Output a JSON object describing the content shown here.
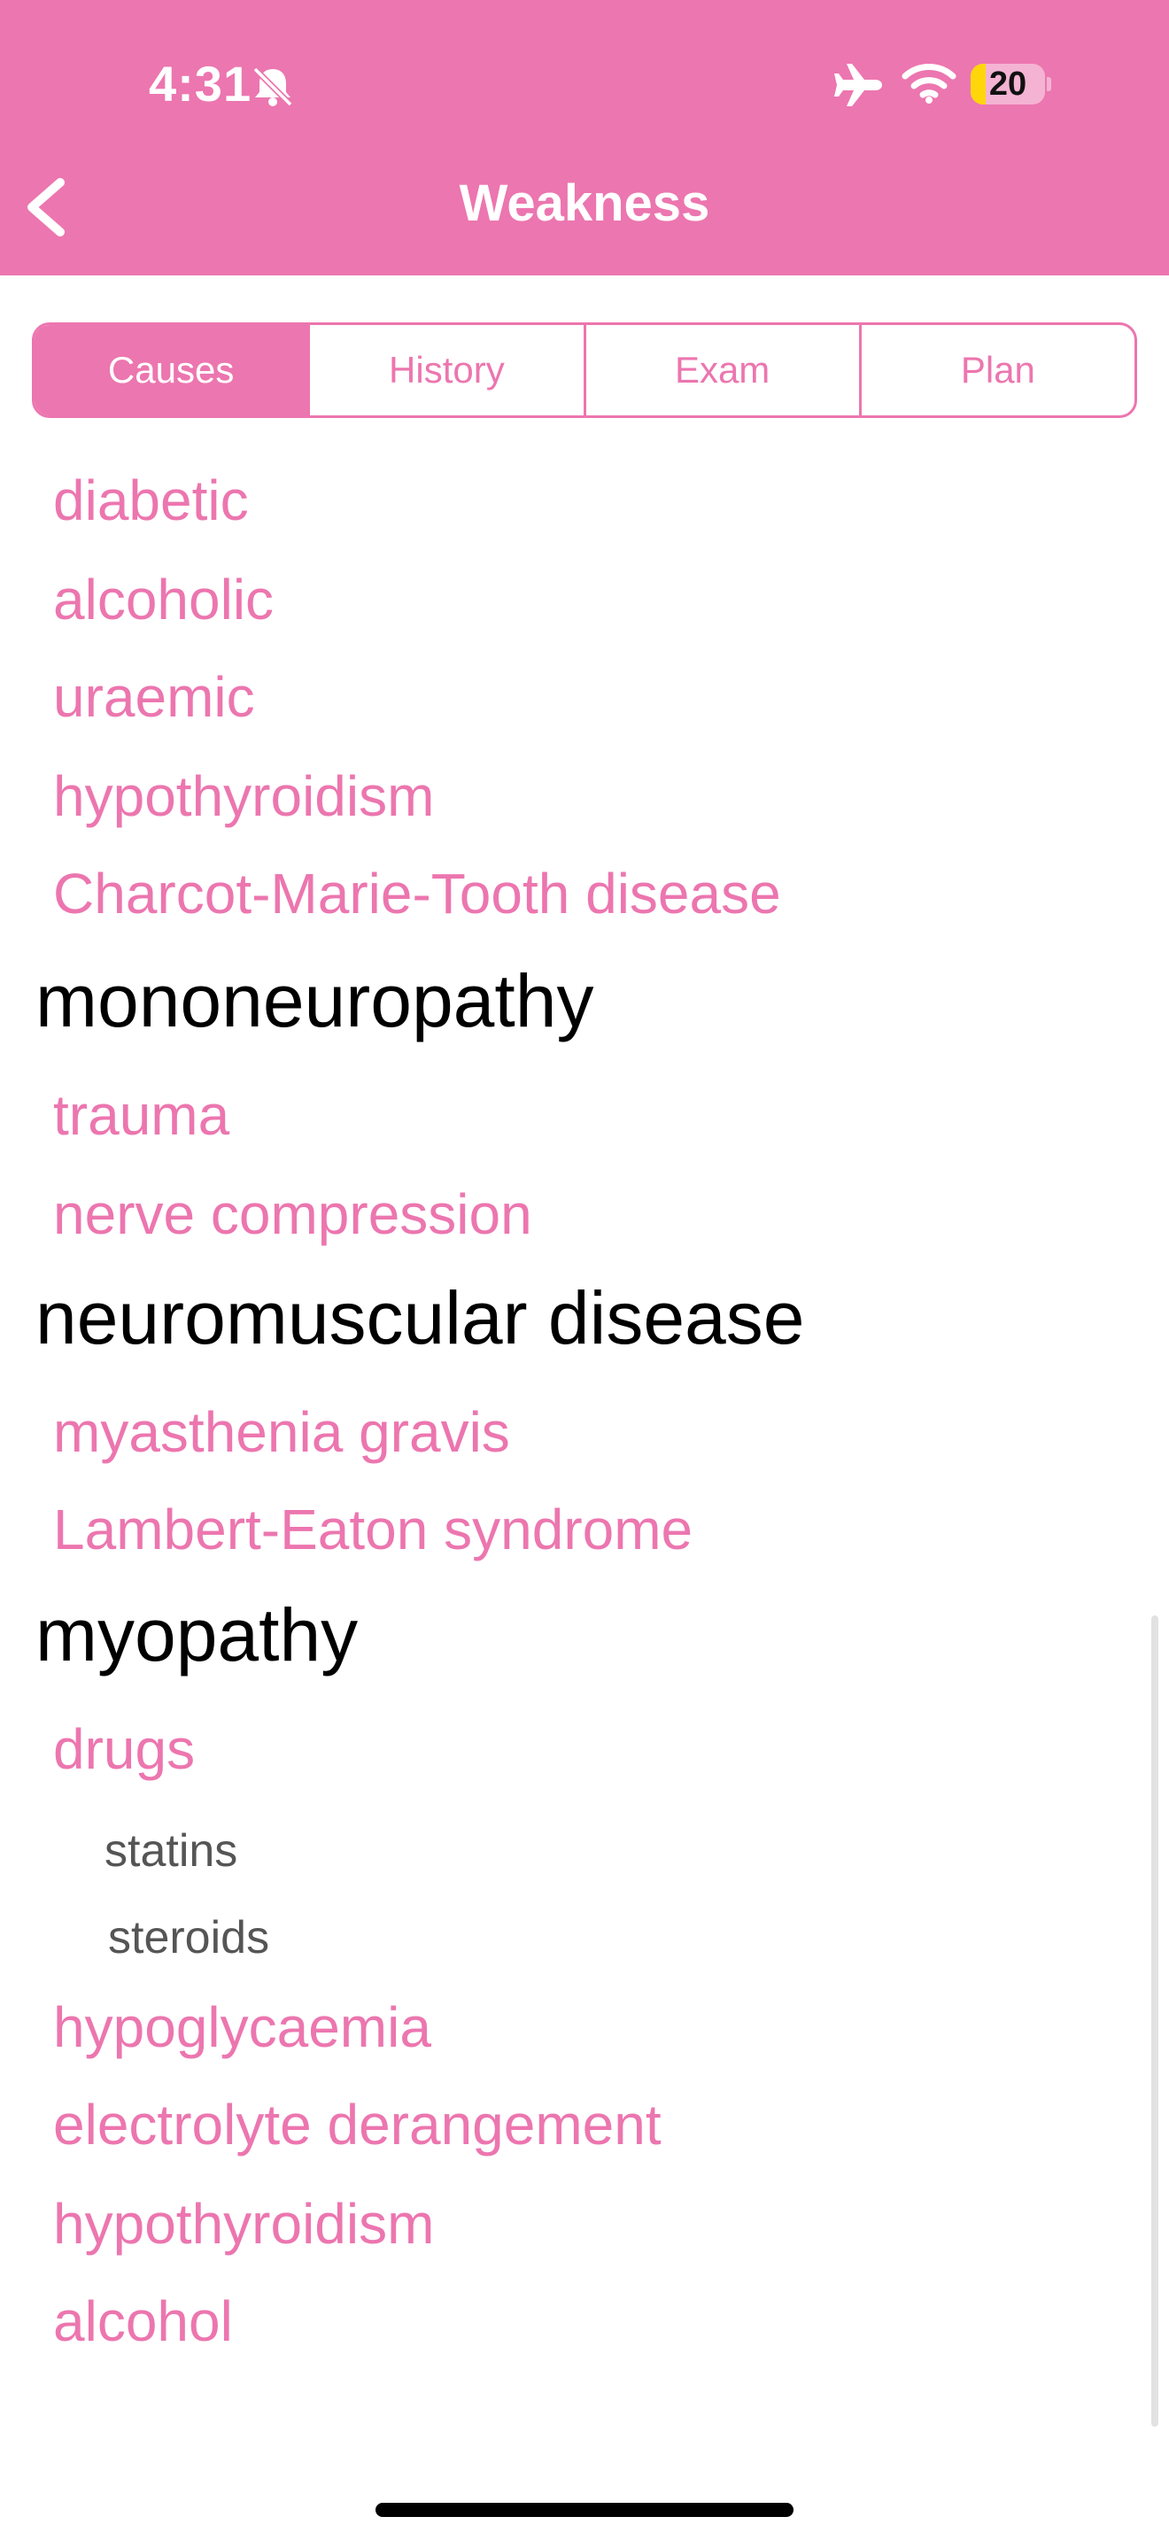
{
  "status_bar": {
    "time": "4:31",
    "battery": "20",
    "battery_level": 0.2
  },
  "nav": {
    "title": "Weakness"
  },
  "tabs": [
    {
      "label": "Causes",
      "active": true
    },
    {
      "label": "History",
      "active": false
    },
    {
      "label": "Exam",
      "active": false
    },
    {
      "label": "Plan",
      "active": false
    }
  ],
  "list": [
    {
      "type": "item",
      "text": "diabetic"
    },
    {
      "type": "item",
      "text": "alcoholic"
    },
    {
      "type": "item",
      "text": "uraemic"
    },
    {
      "type": "item",
      "text": "hypothyroidism"
    },
    {
      "type": "item",
      "text": "Charcot-Marie-Tooth disease"
    },
    {
      "type": "heading",
      "text": "mononeuropathy"
    },
    {
      "type": "item",
      "text": "trauma"
    },
    {
      "type": "item",
      "text": "nerve compression"
    },
    {
      "type": "heading",
      "text": "neuromuscular disease"
    },
    {
      "type": "item",
      "text": "myasthenia gravis"
    },
    {
      "type": "item",
      "text": "Lambert-Eaton syndrome"
    },
    {
      "type": "heading",
      "text": "myopathy"
    },
    {
      "type": "item",
      "text": "drugs"
    },
    {
      "type": "sub",
      "text": "statins"
    },
    {
      "type": "sub",
      "text": "steroids"
    },
    {
      "type": "item",
      "text": "hypoglycaemia"
    },
    {
      "type": "item",
      "text": "electrolyte derangement"
    },
    {
      "type": "item",
      "text": "hypothyroidism"
    },
    {
      "type": "item",
      "text": "alcohol"
    }
  ],
  "colors": {
    "accent": "#EC76AF",
    "heading": "#000000",
    "subitem": "#555555"
  },
  "icons": [
    "bell-slash-icon",
    "airplane-icon",
    "wifi-icon",
    "battery-icon",
    "chevron-left-icon"
  ]
}
